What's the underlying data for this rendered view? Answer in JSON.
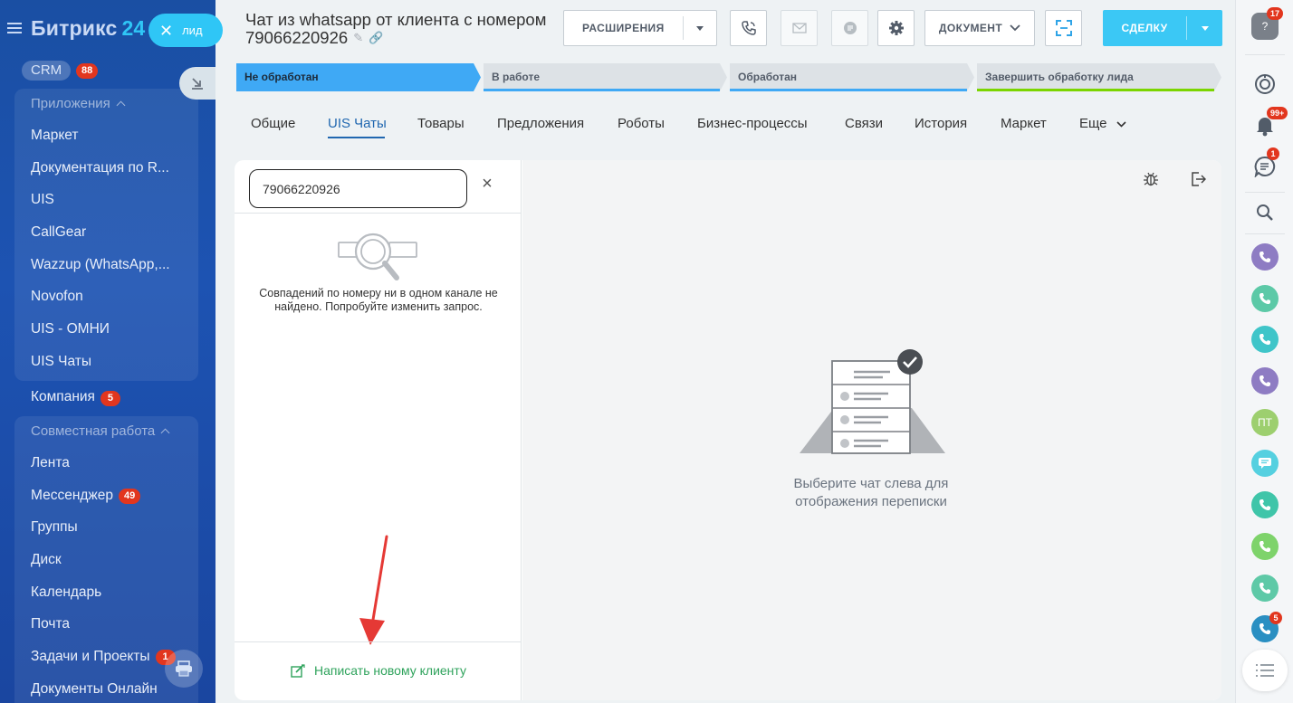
{
  "brand": {
    "name": "Битрикс",
    "num": "24"
  },
  "lid_tag": {
    "label": "лид"
  },
  "sidebar": {
    "crm": {
      "label": "CRM",
      "badge": "88"
    },
    "apps_group": {
      "title": "Приложения",
      "items": [
        "Маркет",
        "Документация по R...",
        "UIS",
        "CallGear",
        "Wazzup (WhatsApp,...",
        "Novofon",
        "UIS - ОМНИ",
        "UIS Чаты"
      ]
    },
    "company": {
      "label": "Компания",
      "badge": "5"
    },
    "work_group": {
      "title": "Совместная работа",
      "items": [
        {
          "label": "Лента",
          "badge": ""
        },
        {
          "label": "Мессенджер",
          "badge": "49"
        },
        {
          "label": "Группы",
          "badge": ""
        },
        {
          "label": "Диск",
          "badge": ""
        },
        {
          "label": "Календарь",
          "badge": ""
        },
        {
          "label": "Почта",
          "badge": ""
        },
        {
          "label": "Задачи и Проекты",
          "badge": "1"
        },
        {
          "label": "Документы Онлайн",
          "badge": ""
        }
      ]
    }
  },
  "header": {
    "title_line1": "Чат из whatsapp от клиента с номером",
    "title_line2": "79066220926",
    "extensions_label": "РАСШИРЕНИЯ",
    "document_label": "ДОКУМЕНТ",
    "deal_label": "СДЕЛКУ"
  },
  "stages": [
    {
      "label": "Не обработан",
      "bg": "#3fa9f5",
      "bar": "#3fa9f5",
      "color": "#1d2b3a"
    },
    {
      "label": "В работе",
      "bg": "#dde2e6",
      "bar": "#3fa9f5",
      "color": "#535c69"
    },
    {
      "label": "Обработан",
      "bg": "#dde2e6",
      "bar": "#3fa9f5",
      "color": "#535c69"
    },
    {
      "label": "Завершить обработку лида",
      "bg": "#dde2e6",
      "bar": "#7bd500",
      "color": "#535c69"
    }
  ],
  "tabs": [
    "Общие",
    "UIS Чаты",
    "Товары",
    "Предложения",
    "Роботы",
    "Бизнес-процессы",
    "Связи",
    "История",
    "Маркет",
    "Еще"
  ],
  "active_tab": "UIS Чаты",
  "chat": {
    "search_value": "79066220926",
    "empty_message": "Совпадений по номеру ни в одном канале не найдено. Попробуйте изменить запрос.",
    "new_client_label": "Написать новому клиенту",
    "placeholder": "Выберите чат слева для отображения переписки"
  },
  "rightbar": {
    "help_badge": "17",
    "notifications_badge": "99+",
    "chat_badge": "1",
    "avatar_initials": "ПТ",
    "last_badge": "5"
  },
  "colors": {
    "sidebar": "#1d53b2",
    "accent": "#2fc6f6",
    "primary_button": "#3bc8f5",
    "badge": "#e2361e",
    "active_tab": "#2067b0",
    "link_green": "#2fa35c"
  }
}
